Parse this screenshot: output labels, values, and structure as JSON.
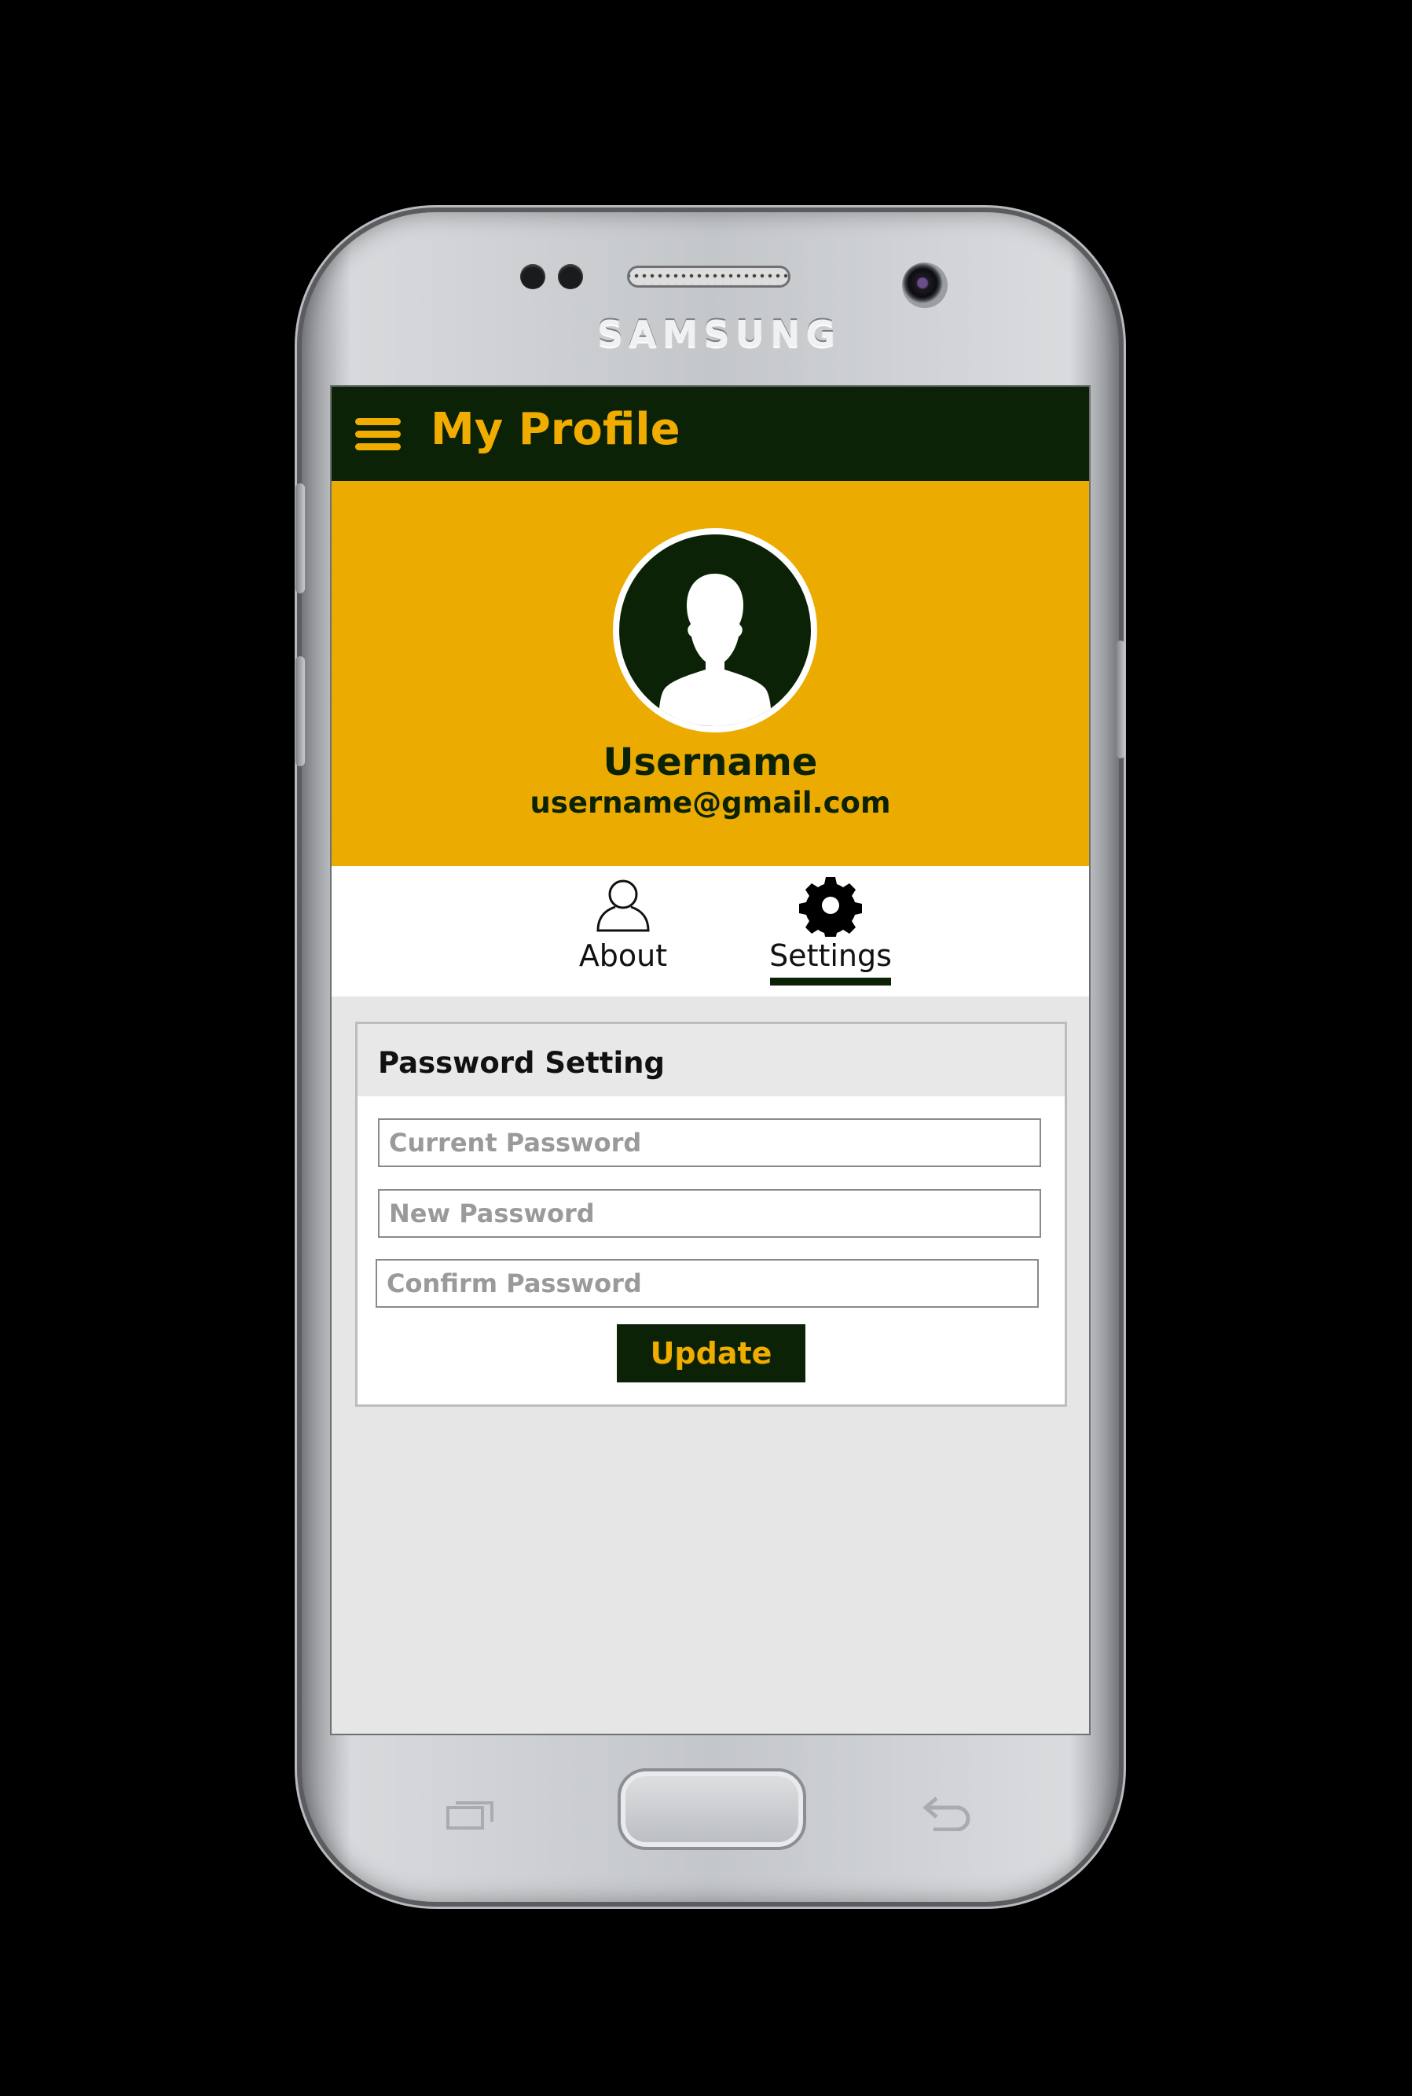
{
  "device": {
    "brand": "SAMSUNG"
  },
  "appbar": {
    "title": "My Profile",
    "menu_icon": "hamburger-menu-icon"
  },
  "profile": {
    "avatar_icon": "user-avatar-icon",
    "username": "Username",
    "email": "username@gmail.com"
  },
  "tabs": [
    {
      "label": "About",
      "icon": "person-outline-icon",
      "selected": false
    },
    {
      "label": "Settings",
      "icon": "gear-icon",
      "selected": true
    }
  ],
  "password_setting": {
    "title": "Password Setting",
    "current_password_placeholder": "Current Password",
    "new_password_placeholder": "New Password",
    "confirm_password_placeholder": "Confirm Password",
    "update_label": "Update"
  },
  "colors": {
    "accent": "#ebab00",
    "dark_green": "#0b2207",
    "panel_background": "#e6e6e6"
  }
}
